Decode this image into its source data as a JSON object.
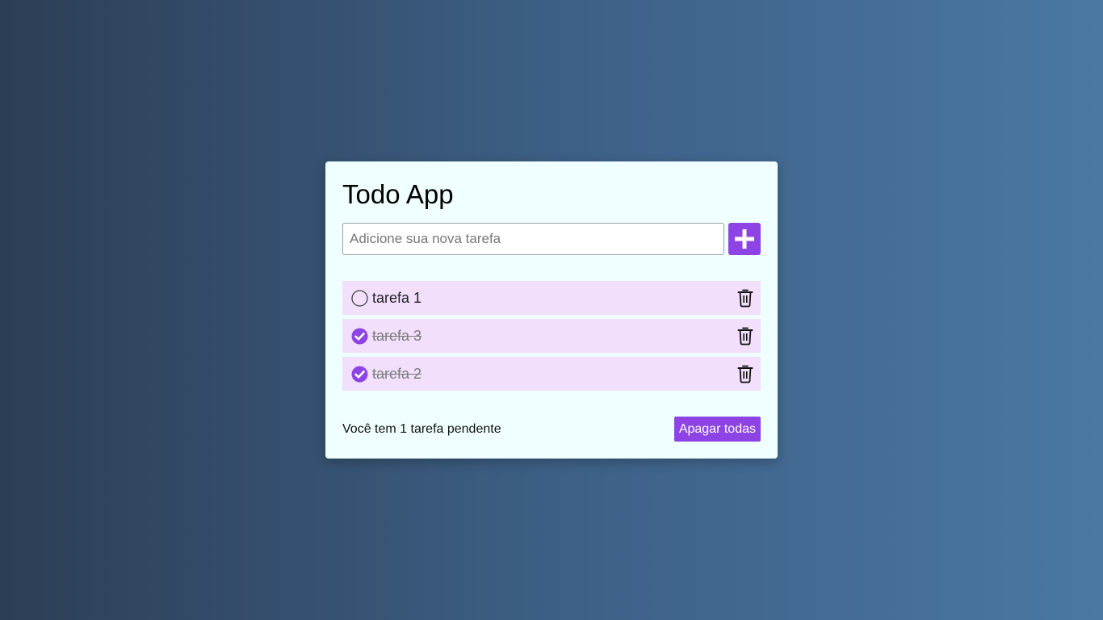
{
  "app": {
    "title": "Todo App"
  },
  "input": {
    "placeholder": "Adicione sua nova tarefa",
    "value": "",
    "add_icon": "plus-icon"
  },
  "tasks": [
    {
      "text": "tarefa 1",
      "done": false
    },
    {
      "text": "tarefa 3",
      "done": true
    },
    {
      "text": "tarefa 2",
      "done": true
    }
  ],
  "footer": {
    "pending_text": "Você tem 1 tarefa pendente",
    "clear_label": "Apagar todas"
  },
  "colors": {
    "accent": "#8e44e4",
    "item_bg": "#f1dffb",
    "card_bg": "#f0ffff"
  }
}
